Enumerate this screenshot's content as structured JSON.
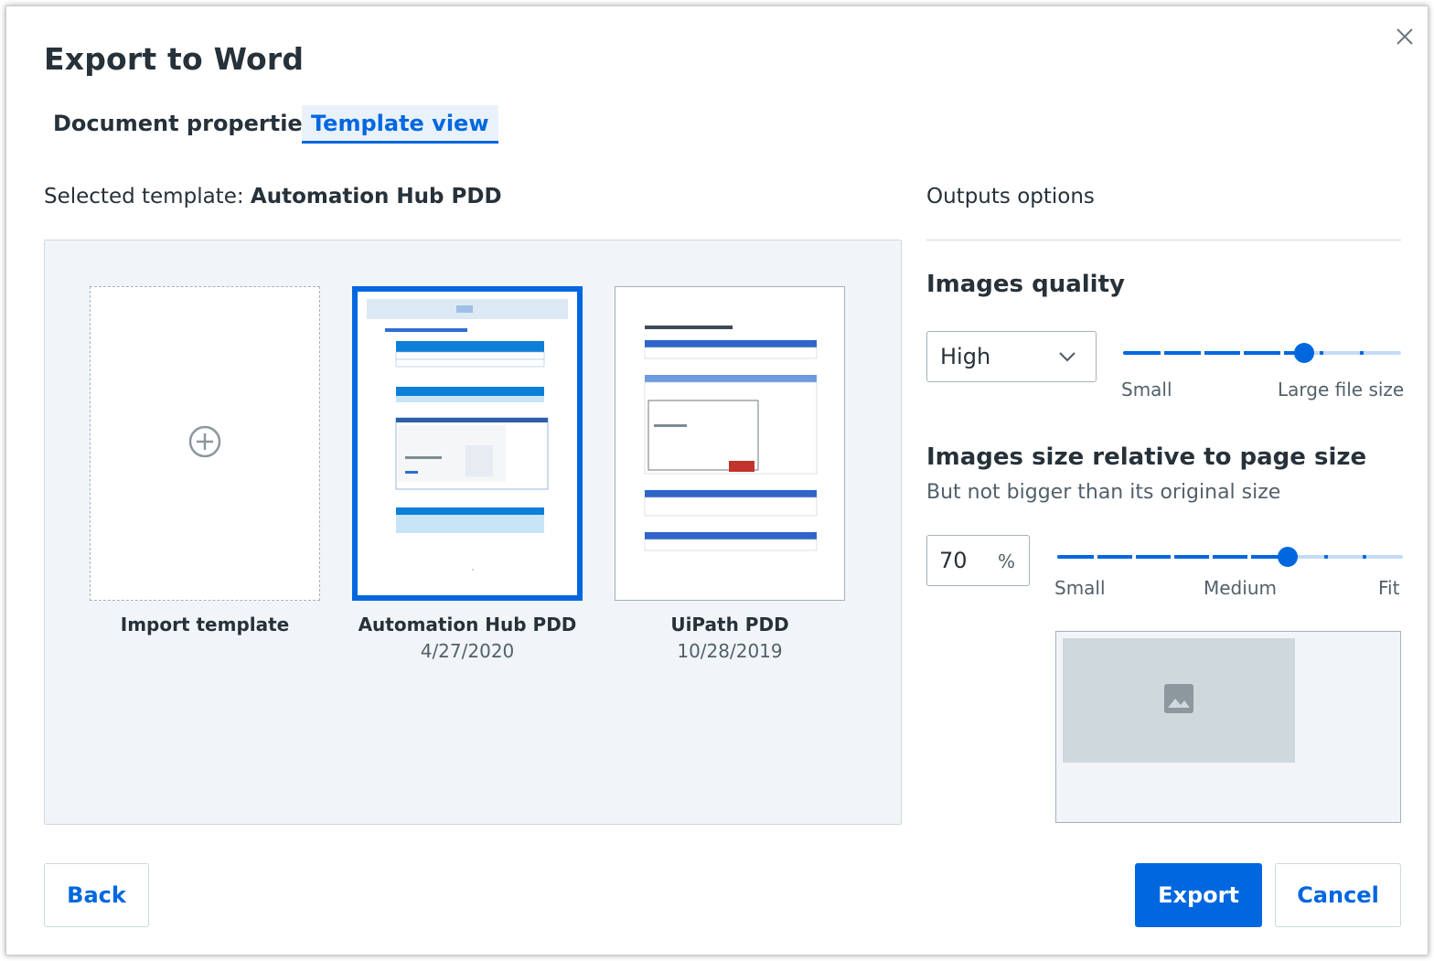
{
  "dialog": {
    "title": "Export to Word",
    "close_icon": "close-icon"
  },
  "tabs": [
    {
      "label": "Document properties",
      "active": false
    },
    {
      "label": "Template view",
      "active": true
    }
  ],
  "template_panel": {
    "selected_prefix": "Selected template: ",
    "selected_name": "Automation Hub PDD",
    "cards": [
      {
        "label": "Import template",
        "date": "",
        "icon": "plus-circle-icon"
      },
      {
        "label": "Automation Hub PDD",
        "date": "4/27/2020",
        "selected": true
      },
      {
        "label": "UiPath PDD",
        "date": "10/28/2019",
        "selected": false
      }
    ]
  },
  "outputs": {
    "title": "Outputs options",
    "images_quality": {
      "title": "Images quality",
      "selected": "High",
      "slider_level": 0.65,
      "min_label": "Small",
      "max_label": "Large file size"
    },
    "images_size": {
      "title": "Images size relative to page size",
      "subtitle": "But not bigger than its original size",
      "value": "70",
      "unit": "%",
      "slider_level": 0.666,
      "labels": [
        "Small",
        "Medium",
        "Fit"
      ],
      "preview_icon": "image-icon"
    }
  },
  "buttons": {
    "back": "Back",
    "export": "Export",
    "cancel": "Cancel"
  },
  "colors": {
    "accent": "#0067df",
    "text": "#273139",
    "muted": "#526069",
    "panel_bg": "#f1f5f8"
  }
}
